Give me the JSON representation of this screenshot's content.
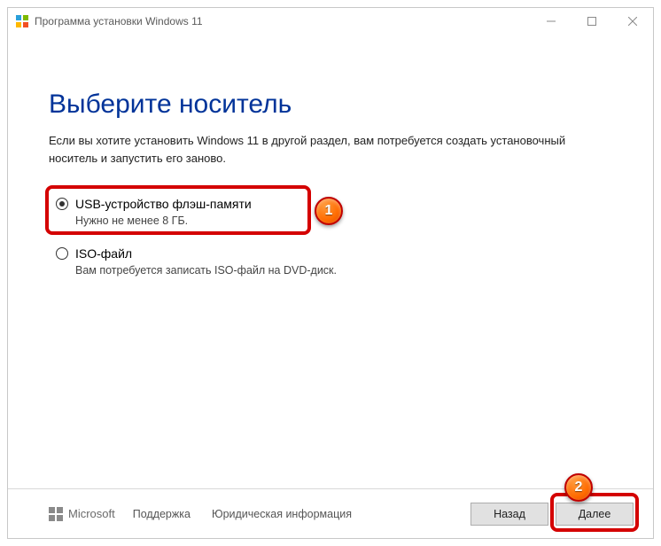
{
  "titlebar": {
    "title": "Программа установки Windows 11"
  },
  "heading": "Выберите носитель",
  "subtext": "Если вы хотите установить Windows 11 в другой раздел, вам потребуется создать установочный носитель и запустить его заново.",
  "options": {
    "usb": {
      "label": "USB-устройство флэш-памяти",
      "desc": "Нужно не менее 8 ГБ."
    },
    "iso": {
      "label": "ISO-файл",
      "desc": "Вам потребуется записать ISO-файл на DVD-диск."
    }
  },
  "footer": {
    "ms": "Microsoft",
    "support": "Поддержка",
    "legal": "Юридическая информация",
    "back": "Назад",
    "next": "Далее"
  },
  "badge": {
    "one": "1",
    "two": "2"
  }
}
